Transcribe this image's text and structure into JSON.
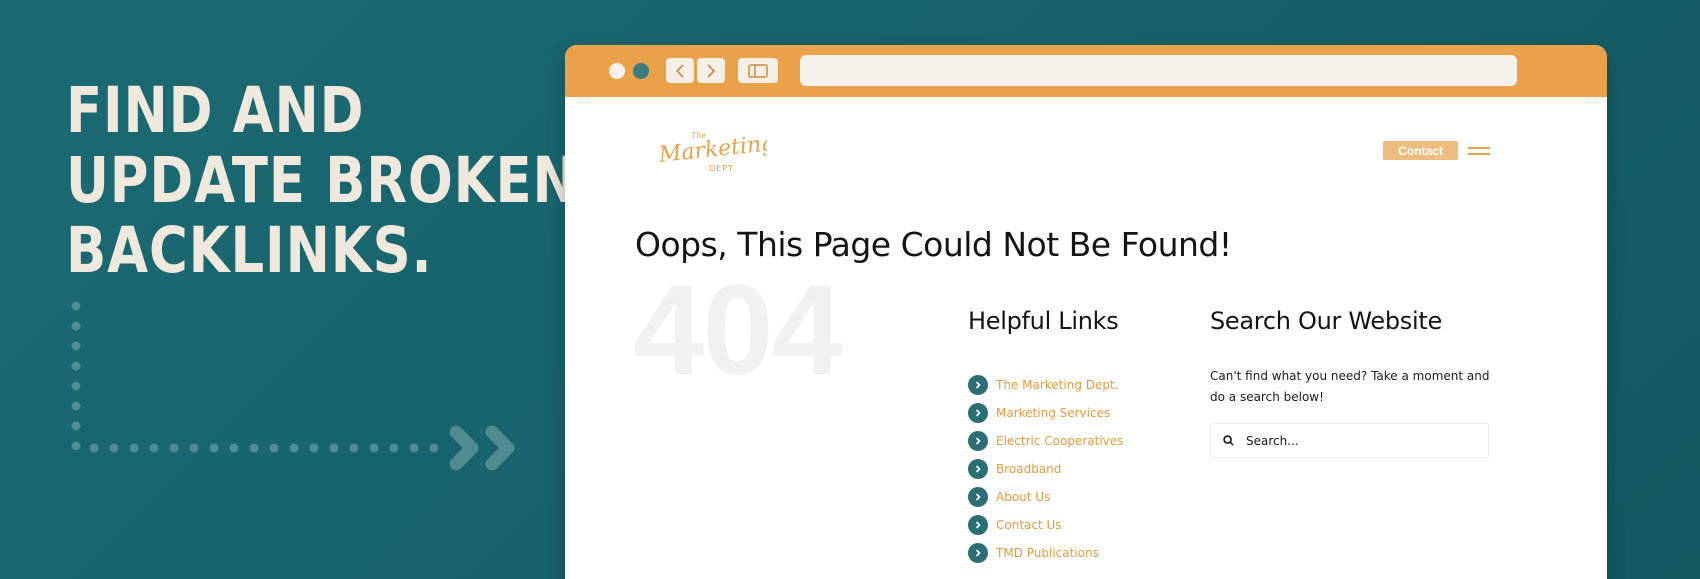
{
  "headline": {
    "lines": [
      "FIND AND",
      "UPDATE BROKEN",
      "BACKLINKS."
    ]
  },
  "colors": {
    "background": "#17626b",
    "accent_orange": "#e9a14a",
    "headline_text": "#efe8dc",
    "bullet_teal": "#2b6e74"
  },
  "browser": {
    "toolbar": {
      "icons": [
        "window-dot-icon",
        "window-dot-icon",
        "chevron-left-icon",
        "chevron-right-icon",
        "sidebar-toggle-icon"
      ]
    },
    "site": {
      "logo": {
        "line_top": "The",
        "line_main": "Marketing",
        "line_bottom": "DEPT."
      },
      "nav": {
        "contact_label": "Contact",
        "menu_icon": "hamburger-icon"
      },
      "page_title": "Oops, This Page Could Not Be Found!",
      "error_code": "404",
      "helpful_links": {
        "title": "Helpful Links",
        "items": [
          {
            "label": "The Marketing Dept."
          },
          {
            "label": "Marketing Services"
          },
          {
            "label": "Electric Cooperatives"
          },
          {
            "label": "Broadband"
          },
          {
            "label": "About Us"
          },
          {
            "label": "Contact Us"
          },
          {
            "label": "TMD Publications"
          }
        ]
      },
      "search": {
        "title": "Search Our Website",
        "description": "Can't find what you need? Take a moment and do a search below!",
        "placeholder": "Search..."
      }
    }
  }
}
